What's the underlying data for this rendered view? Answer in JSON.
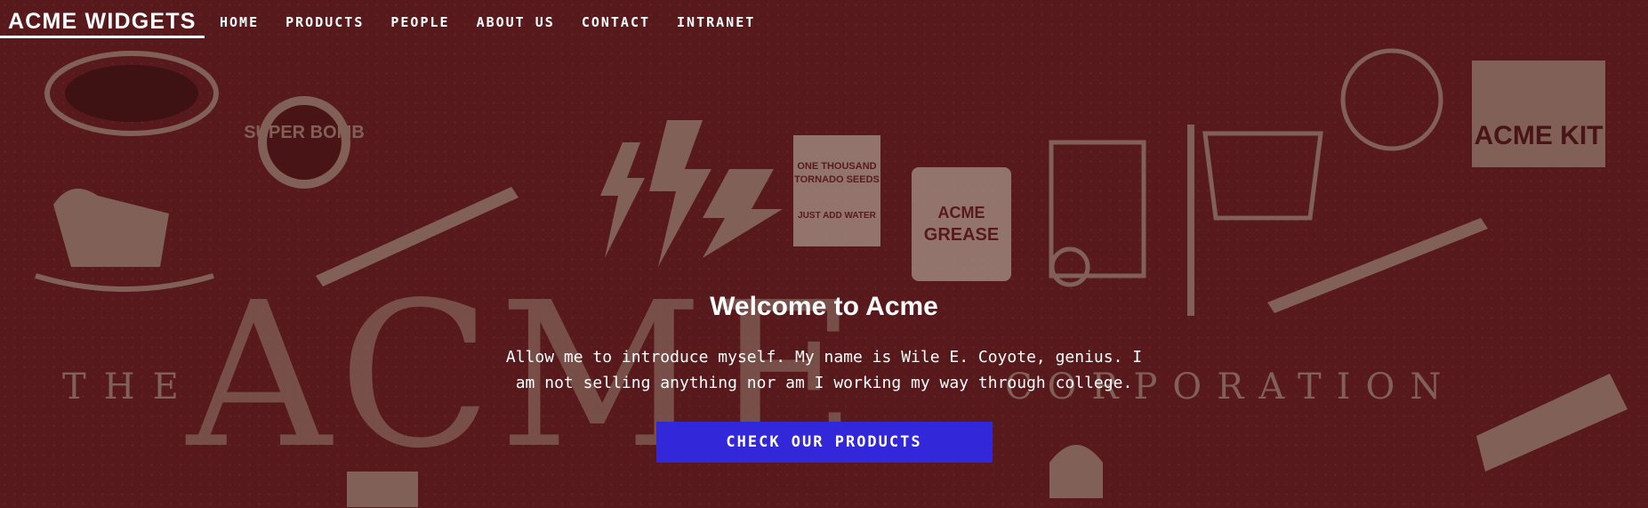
{
  "brand": "ACME WIDGETS",
  "nav": [
    {
      "label": "HOME"
    },
    {
      "label": "PRODUCTS"
    },
    {
      "label": "PEOPLE"
    },
    {
      "label": "ABOUT US"
    },
    {
      "label": "CONTACT"
    },
    {
      "label": "INTRANET"
    }
  ],
  "hero": {
    "title": "Welcome to Acme",
    "text": "Allow me to introduce myself. My name is Wile E. Coyote, genius. I am not selling anything nor am I working my way through college.",
    "cta_label": "CHECK OUR PRODUCTS"
  },
  "background": {
    "headline_left": "THE",
    "headline_big": "ACME",
    "headline_right": "CORPORATION",
    "props": [
      "SUPER BOMB",
      "ACME GREASE",
      "ACME KIT",
      "ONE THOUSAND TORNADO SEEDS",
      "JUST ADD WATER"
    ]
  },
  "colors": {
    "background": "#5e1d20",
    "illustration": "#9a8276",
    "cta": "#3228d9",
    "text": "#ffffff"
  }
}
